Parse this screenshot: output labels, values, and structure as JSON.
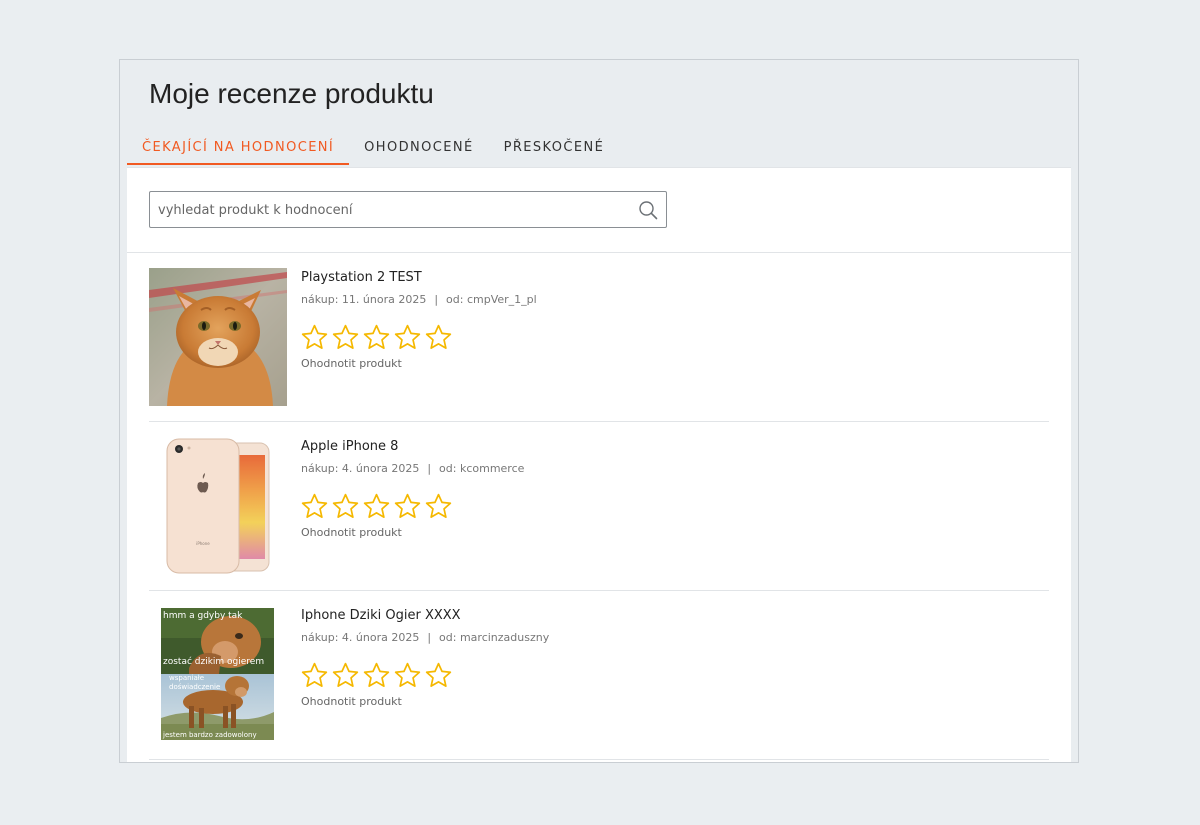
{
  "page": {
    "title": "Moje recenze produktu"
  },
  "tabs": [
    {
      "label": "ČEKAJÍCÍ NA HODNOCENÍ",
      "active": true
    },
    {
      "label": "OHODNOCENÉ",
      "active": false
    },
    {
      "label": "PŘESKOČENÉ",
      "active": false
    }
  ],
  "search": {
    "placeholder": "vyhledat produkt k hodnocení",
    "value": "",
    "icon": "search-icon"
  },
  "colors": {
    "accent": "#f15a22",
    "star": "#f5b800",
    "background": "#eaeef1"
  },
  "products": [
    {
      "name": "Playstation 2 TEST",
      "purchase": "nákup: 11. února 2025",
      "separator": "|",
      "seller": "od: cmpVer_1_pl",
      "rating": 0,
      "max_rating": 5,
      "rate_label": "Ohodnotit produkt",
      "image": "cat-photo"
    },
    {
      "name": "Apple iPhone 8",
      "purchase": "nákup: 4. února 2025",
      "separator": "|",
      "seller": "od: kcommerce",
      "rating": 0,
      "max_rating": 5,
      "rate_label": "Ohodnotit produkt",
      "image": "iphone-photo",
      "image_text": "iPhone"
    },
    {
      "name": "Iphone Dziki Ogier XXXX",
      "purchase": "nákup: 4. února 2025",
      "separator": "|",
      "seller": "od: marcinzaduszny",
      "rating": 0,
      "max_rating": 5,
      "rate_label": "Ohodnotit produkt",
      "image": "meme-photo",
      "image_text": [
        "hmm a gdyby tak",
        "zostać dzikim ogierem",
        "wspaniałe",
        "doświadczenie",
        "jestem bardzo zadowolony"
      ]
    }
  ]
}
